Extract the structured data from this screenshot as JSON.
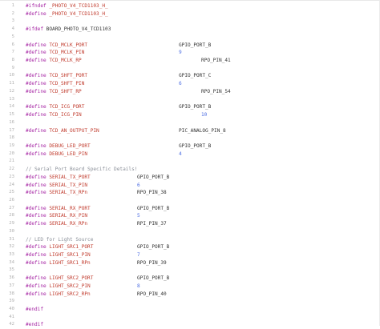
{
  "lines": [
    {
      "n": "1",
      "kw": "#ifndef",
      "rest": " _PHOTO_V4_TCD1103_H_",
      "rest_cls": "mac"
    },
    {
      "n": "2",
      "kw": "#define",
      "rest": " _PHOTO_V4_TCD1103_H_",
      "rest_cls": "mac"
    },
    {
      "n": "3"
    },
    {
      "n": "4",
      "kw": "#ifdef",
      "rest": " BOARD_PHOTO_V4_TCD1103",
      "rest_cls": "plain"
    },
    {
      "n": "5"
    },
    {
      "n": "6",
      "kw": "#define",
      "name": "TCD_MCLK_PORT",
      "value": "GPIO_PORT_B",
      "col": "far"
    },
    {
      "n": "7",
      "kw": "#define",
      "name": "TCD_MCLK_PIN",
      "value": "9",
      "col": "far",
      "num": true
    },
    {
      "n": "8",
      "kw": "#define",
      "name": "TCD_MCLK_RP",
      "value": "RPO_PIN_41",
      "col": "farther"
    },
    {
      "n": "9"
    },
    {
      "n": "10",
      "kw": "#define",
      "name": "TCD_SHFT_PORT",
      "value": "GPIO_PORT_C",
      "col": "far"
    },
    {
      "n": "11",
      "kw": "#define",
      "name": "TCD_SHFT_PIN",
      "value": "6",
      "col": "far",
      "num": true
    },
    {
      "n": "12",
      "kw": "#define",
      "name": "TCD_SHFT_RP",
      "value": "RPO_PIN_54",
      "col": "farther"
    },
    {
      "n": "13"
    },
    {
      "n": "14",
      "kw": "#define",
      "name": "TCD_ICG_PORT",
      "value": "GPIO_PORT_B",
      "col": "far"
    },
    {
      "n": "15",
      "kw": "#define",
      "name": "TCD_ICG_PIN",
      "value": "10",
      "col": "farther",
      "num": true
    },
    {
      "n": "16"
    },
    {
      "n": "17",
      "kw": "#define",
      "name": "TCD_AN_OUTPUT_PIN",
      "value": "PIC_ANALOG_PIN_8",
      "col": "far"
    },
    {
      "n": "18"
    },
    {
      "n": "19",
      "kw": "#define",
      "name": "DEBUG_LED_PORT",
      "value": "GPIO_PORT_B",
      "col": "far"
    },
    {
      "n": "20",
      "kw": "#define",
      "name": "DEBUG_LED_PIN",
      "value": "4",
      "col": "far",
      "num": true
    },
    {
      "n": "21"
    },
    {
      "n": "22",
      "comment": "// Serial Port Board Specific Details!"
    },
    {
      "n": "23",
      "kw": "#define",
      "name": "SERIAL_TX_PORT",
      "value": "GPIO_PORT_B",
      "col": "mid"
    },
    {
      "n": "24",
      "kw": "#define",
      "name": "SERIAL_TX_PIN",
      "value": "6",
      "col": "mid",
      "num": true
    },
    {
      "n": "25",
      "kw": "#define",
      "name": "SERIAL_TX_RPn",
      "value": "RPO_PIN_38",
      "col": "mid"
    },
    {
      "n": "26"
    },
    {
      "n": "27",
      "kw": "#define",
      "name": "SERIAL_RX_PORT",
      "value": "GPIO_PORT_B",
      "col": "mid"
    },
    {
      "n": "28",
      "kw": "#define",
      "name": "SERIAL_RX_PIN",
      "value": "5",
      "col": "mid",
      "num": true
    },
    {
      "n": "29",
      "kw": "#define",
      "name": "SERIAL_RX_RPn",
      "value": "RPI_PIN_37",
      "col": "mid"
    },
    {
      "n": "30"
    },
    {
      "n": "31",
      "comment": "// LED for Light Source"
    },
    {
      "n": "32",
      "kw": "#define",
      "name": "LIGHT_SRC1_PORT",
      "value": "GPIO_PORT_B",
      "col": "mid"
    },
    {
      "n": "33",
      "kw": "#define",
      "name": "LIGHT_SRC1_PIN",
      "value": "7",
      "col": "mid",
      "num": true
    },
    {
      "n": "34",
      "kw": "#define",
      "name": "LIGHT_SRC1_RPn",
      "value": "RPO_PIN_39",
      "col": "mid"
    },
    {
      "n": "35"
    },
    {
      "n": "36",
      "kw": "#define",
      "name": "LIGHT_SRC2_PORT",
      "value": "GPIO_PORT_B",
      "col": "mid"
    },
    {
      "n": "37",
      "kw": "#define",
      "name": "LIGHT_SRC2_PIN",
      "value": "8",
      "col": "mid",
      "num": true
    },
    {
      "n": "38",
      "kw": "#define",
      "name": "LIGHT_SRC2_RPn",
      "value": "RPO_PIN_40",
      "col": "mid"
    },
    {
      "n": "39"
    },
    {
      "n": "40",
      "kw": "#endif"
    },
    {
      "n": "41"
    },
    {
      "n": "42",
      "kw": "#endif"
    }
  ]
}
